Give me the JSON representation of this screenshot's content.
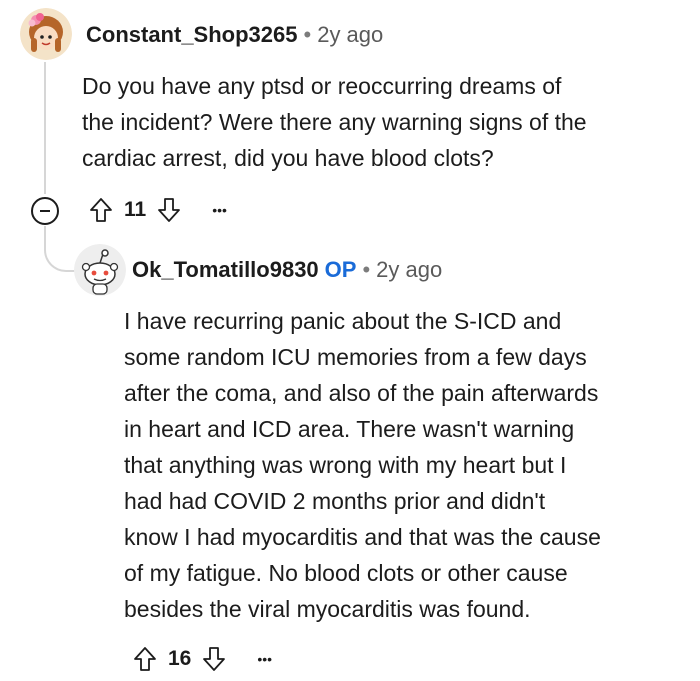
{
  "comments": [
    {
      "username": "Constant_Shop3265",
      "time": "2y ago",
      "body_lines": [
        "Do you have any ptsd or reoccurring dreams of",
        "the incident? Were there any warning signs of the",
        "cardiac arrest, did you have blood clots?"
      ],
      "votes": "11"
    },
    {
      "username": "Ok_Tomatillo9830",
      "op_badge": "OP",
      "time": "2y ago",
      "body_lines": [
        "I have recurring panic about the S-ICD and",
        "some random ICU memories from a few days",
        "after the coma, and also of the pain afterwards",
        "in heart and ICD area. There wasn't warning",
        "that anything was wrong with my heart but I",
        "had had COVID 2 months prior and didn't",
        "know I had myocarditis and that was the cause",
        "of my fatigue. No blood clots or other cause",
        "besides the viral myocarditis was found."
      ],
      "votes": "16"
    }
  ],
  "separator": "•",
  "more_label": "•••",
  "icons": [
    "avatar-girl",
    "avatar-snoo",
    "upvote-icon",
    "downvote-icon",
    "collapse-icon",
    "more-icon"
  ]
}
